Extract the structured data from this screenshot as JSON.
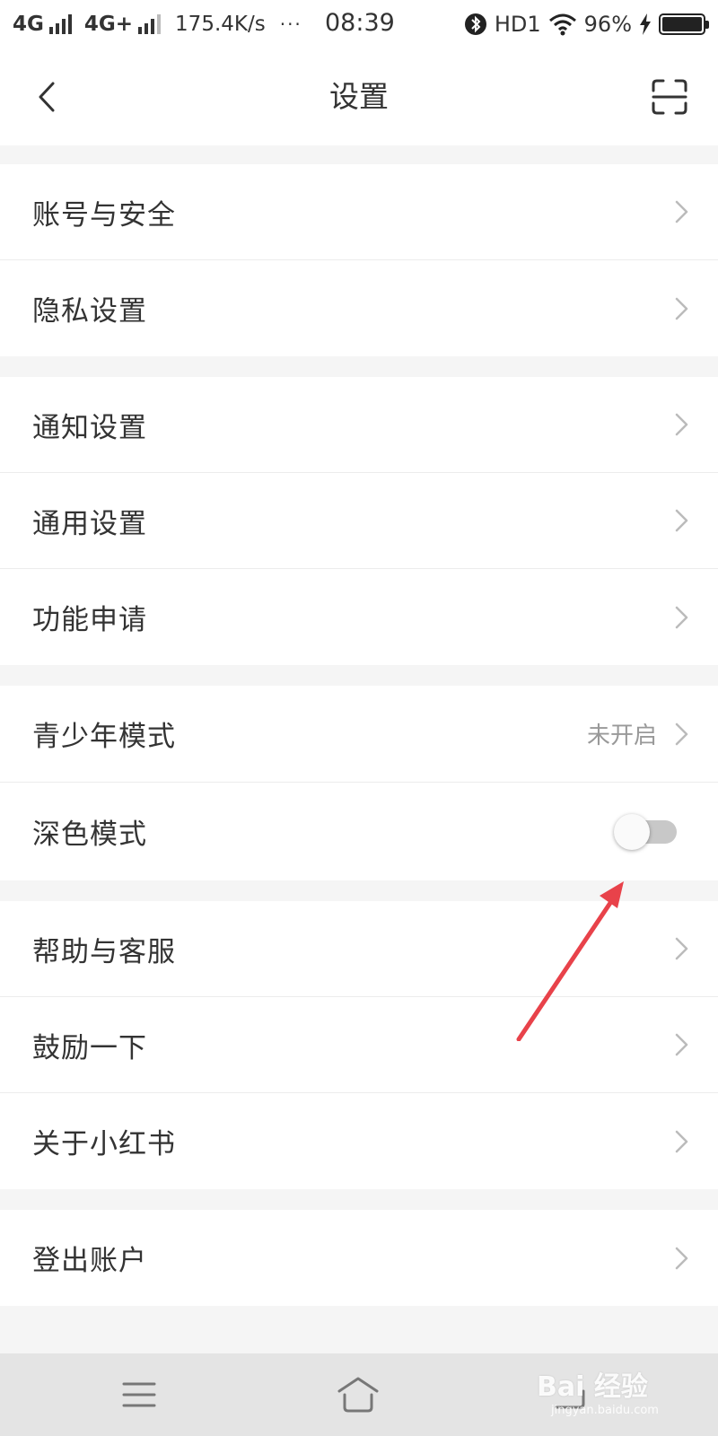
{
  "status_bar": {
    "network1": "4G",
    "network2": "4G+",
    "speed": "175.4K/s",
    "more": "···",
    "time": "08:39",
    "hd": "HD1",
    "battery": "96%"
  },
  "header": {
    "title": "设置",
    "back_icon": "chevron-left-icon",
    "scan_icon": "scan-icon"
  },
  "groups": [
    {
      "items": [
        {
          "label": "账号与安全"
        },
        {
          "label": "隐私设置"
        }
      ]
    },
    {
      "items": [
        {
          "label": "通知设置"
        },
        {
          "label": "通用设置"
        },
        {
          "label": "功能申请"
        }
      ]
    },
    {
      "items": [
        {
          "label": "青少年模式",
          "value": "未开启"
        },
        {
          "label": "深色模式",
          "toggle": false
        }
      ]
    },
    {
      "items": [
        {
          "label": "帮助与客服"
        },
        {
          "label": "鼓励一下"
        },
        {
          "label": "关于小红书"
        }
      ]
    },
    {
      "items": [
        {
          "label": "登出账户"
        }
      ]
    }
  ],
  "system_nav": {
    "menu_icon": "menu-icon",
    "home_icon": "home-icon",
    "back_icon": "return-icon"
  },
  "watermark": {
    "logo": "Bai 经验",
    "sub": "jingyan.baidu.com"
  },
  "colors": {
    "annotation_arrow": "#e8424a",
    "toggle_off_track": "#c8c8c8",
    "page_background": "#f5f5f5"
  }
}
